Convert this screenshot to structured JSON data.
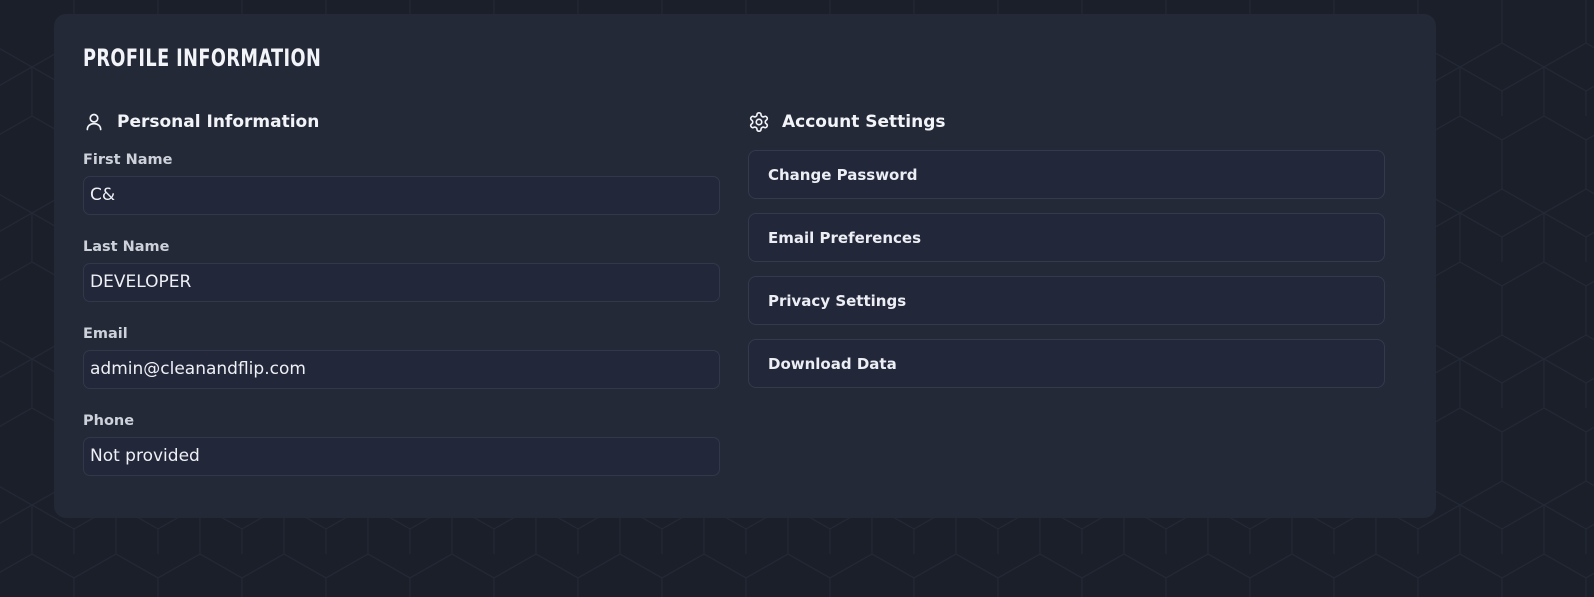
{
  "card": {
    "title": "PROFILE INFORMATION"
  },
  "personal": {
    "icon": "user-icon",
    "title": "Personal Information",
    "fields": [
      {
        "label": "First Name",
        "value": "C&"
      },
      {
        "label": "Last Name",
        "value": "DEVELOPER"
      },
      {
        "label": "Email",
        "value": "admin@cleanandflip.com"
      },
      {
        "label": "Phone",
        "value": "Not provided"
      }
    ]
  },
  "account": {
    "icon": "gear-icon",
    "title": "Account Settings",
    "buttons": [
      {
        "label": "Change Password"
      },
      {
        "label": "Email Preferences"
      },
      {
        "label": "Privacy Settings"
      },
      {
        "label": "Download Data"
      }
    ]
  },
  "colors": {
    "page_background": "#1b1f29",
    "card_background": "#242938",
    "field_background": "#22273a",
    "border": "#323849",
    "text": "#eef0f5"
  }
}
